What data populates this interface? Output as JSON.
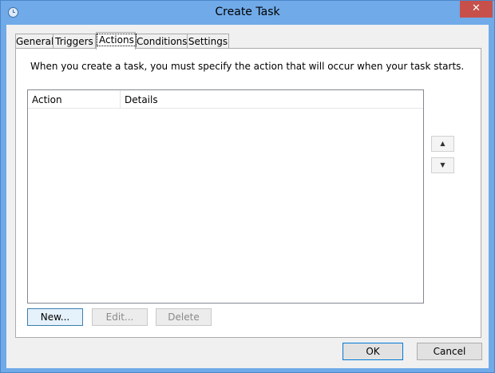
{
  "window": {
    "title": "Create Task",
    "close_label": "✕"
  },
  "tabs": [
    {
      "label": "General"
    },
    {
      "label": "Triggers"
    },
    {
      "label": "Actions"
    },
    {
      "label": "Conditions"
    },
    {
      "label": "Settings"
    }
  ],
  "active_tab": "Actions",
  "actions_panel": {
    "description": "When you create a task, you must specify the action that will occur when your task starts.",
    "columns": [
      "Action",
      "Details"
    ],
    "rows": [],
    "move_up_icon": "▲",
    "move_down_icon": "▼",
    "new_button": "New...",
    "edit_button": "Edit...",
    "delete_button": "Delete"
  },
  "footer": {
    "ok_button": "OK",
    "cancel_button": "Cancel"
  },
  "colors": {
    "title_bar": "#70aae8",
    "close_button": "#c7504a",
    "dialog_bg": "#f0f0f0"
  }
}
